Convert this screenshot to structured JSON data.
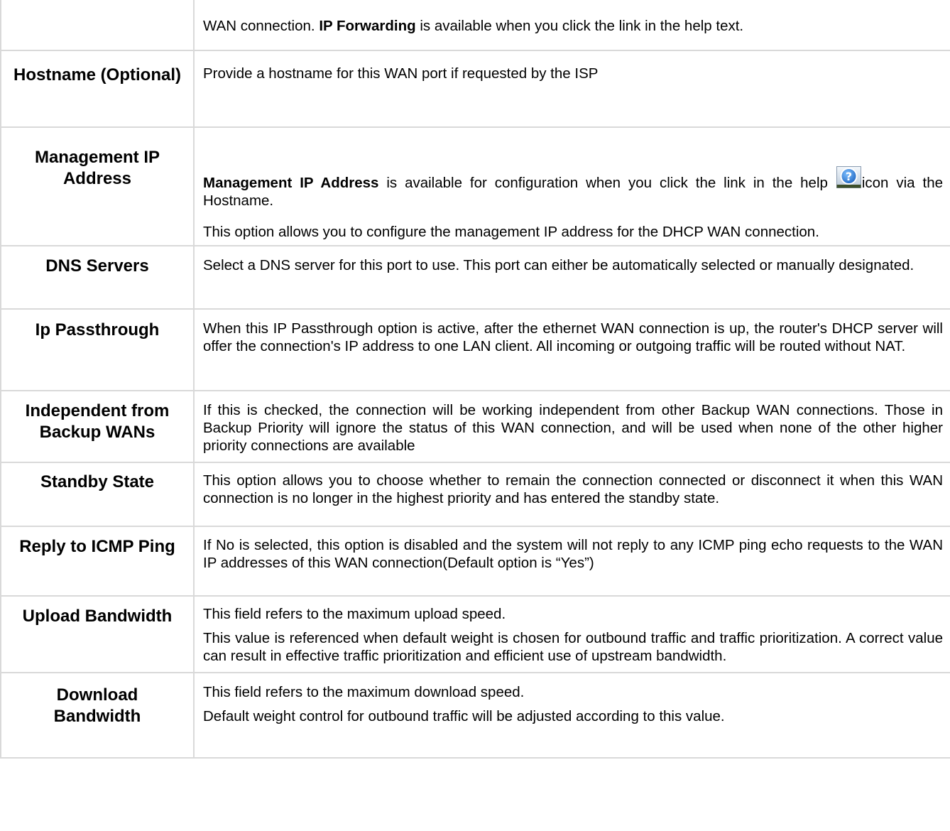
{
  "rows": [
    {
      "label": "",
      "desc_pre": "WAN connection. ",
      "desc_bold": "IP Forwarding",
      "desc_post": " is available when you click the link in the help text."
    },
    {
      "label": "Hostname (Optional)",
      "desc": "Provide a hostname for this WAN port if requested by the ISP"
    },
    {
      "label": "Management IP Address",
      "desc_bold": "Management IP Address",
      "desc_pre": " is available for configuration when you click the link in the help ",
      "desc_icon": "help-question-icon",
      "desc_post": "icon via the Hostname.",
      "desc2": "This option allows you to configure the management IP address for the DHCP WAN connection."
    },
    {
      "label": "DNS Servers",
      "desc": "Select a DNS server for this port to use. This port can either be automatically selected or manually designated."
    },
    {
      "label": "Ip Passthrough",
      "desc": "When this IP Passthrough option is active, after the ethernet WAN connection is up, the router's DHCP server will offer the connection's IP address to one LAN client. All incoming or outgoing traffic will be routed without NAT."
    },
    {
      "label": "Independent from Backup WANs",
      "desc": "If this is checked, the connection will be working independent from other Backup WAN connections. Those in Backup Priority will ignore the status of this WAN connection, and will be used when none of the other higher priority connections are available"
    },
    {
      "label": "Standby State",
      "desc": "This option allows you to choose whether to remain the connection connected or disconnect it when this WAN connection is no longer in the highest priority and has entered the standby state."
    },
    {
      "label": "Reply to ICMP Ping",
      "desc": "If No is selected, this option is disabled and the system will not reply to any ICMP ping echo requests to the WAN IP addresses of this WAN connection(Default option is “Yes”)"
    },
    {
      "label": "Upload Bandwidth",
      "desc": "This field refers to the maximum upload speed.",
      "desc2": "This value is referenced when default weight is chosen for outbound traffic and traffic prioritization. A correct value can result in effective traffic prioritization and efficient use of upstream bandwidth."
    },
    {
      "label": "Download Bandwidth",
      "desc": "This field refers to the maximum download speed.",
      "desc2": "Default weight control for outbound traffic will be adjusted according to this value."
    }
  ],
  "colors": {
    "border": "#d9d9d9",
    "text": "#000000",
    "icon_blue": "#2e7dd1"
  }
}
